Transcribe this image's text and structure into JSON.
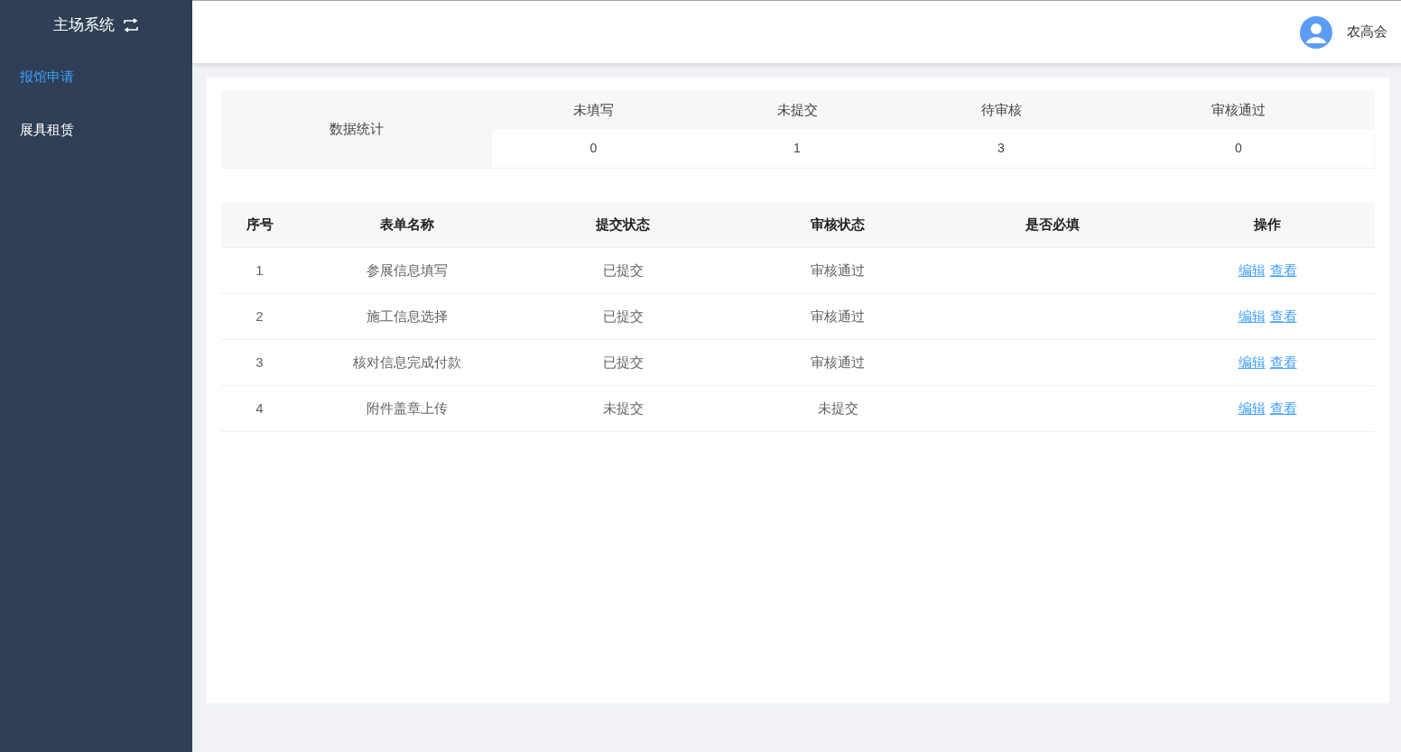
{
  "sidebar": {
    "title": "主场系统",
    "items": [
      {
        "label": "报馆申请",
        "selected": true
      },
      {
        "label": "展具租赁",
        "selected": false
      }
    ]
  },
  "header": {
    "user": "农高会"
  },
  "stats": {
    "label": "数据统计",
    "columns": [
      {
        "name": "未填写",
        "value": "0"
      },
      {
        "name": "未提交",
        "value": "1"
      },
      {
        "name": "待审核",
        "value": "3"
      },
      {
        "name": "审核通过",
        "value": "0"
      }
    ]
  },
  "table": {
    "columns": [
      "序号",
      "表单名称",
      "提交状态",
      "审核状态",
      "是否必填",
      "操作"
    ],
    "rows": [
      {
        "index": "1",
        "name": "参展信息填写",
        "submit_status": "已提交",
        "review_status": "审核通过",
        "actions": [
          "编辑",
          "查看"
        ]
      },
      {
        "index": "2",
        "name": "施工信息选择",
        "submit_status": "已提交",
        "review_status": "审核通过",
        "actions": [
          "编辑",
          "查看"
        ]
      },
      {
        "index": "3",
        "name": "核对信息完成付款",
        "submit_status": "已提交",
        "review_status": "审核通过",
        "actions": [
          "编辑",
          "查看"
        ]
      },
      {
        "index": "4",
        "name": "附件盖章上传",
        "submit_status": "未提交",
        "review_status": "未提交",
        "actions": [
          "编辑",
          "查看"
        ]
      }
    ]
  }
}
